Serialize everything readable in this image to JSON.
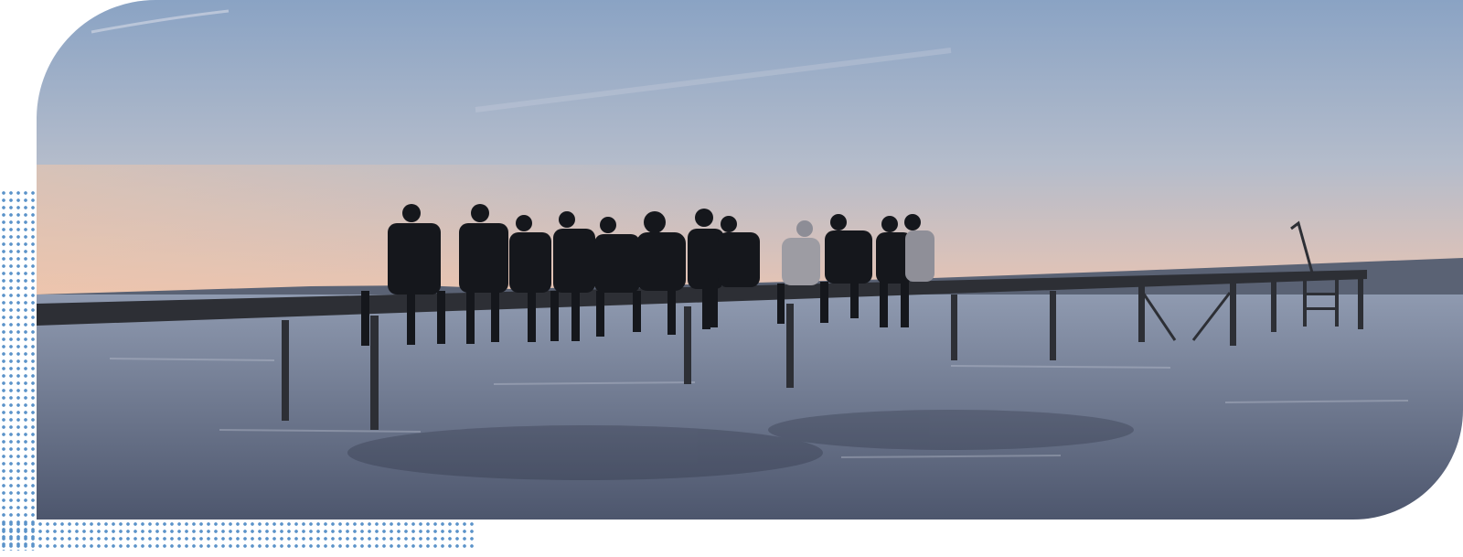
{
  "colors": {
    "dot": "#5b93c9",
    "sky_top": "#8aa3c4",
    "sky_mid": "#b4bccb",
    "sky_horizon": "#e8c4b3",
    "water_top": "#8f9ab0",
    "water_bottom": "#4d566d",
    "silhouette": "#15171c"
  },
  "image": {
    "icon": "lake-pier-group-photo",
    "subject": "people-sitting-on-pier-at-sunset"
  }
}
